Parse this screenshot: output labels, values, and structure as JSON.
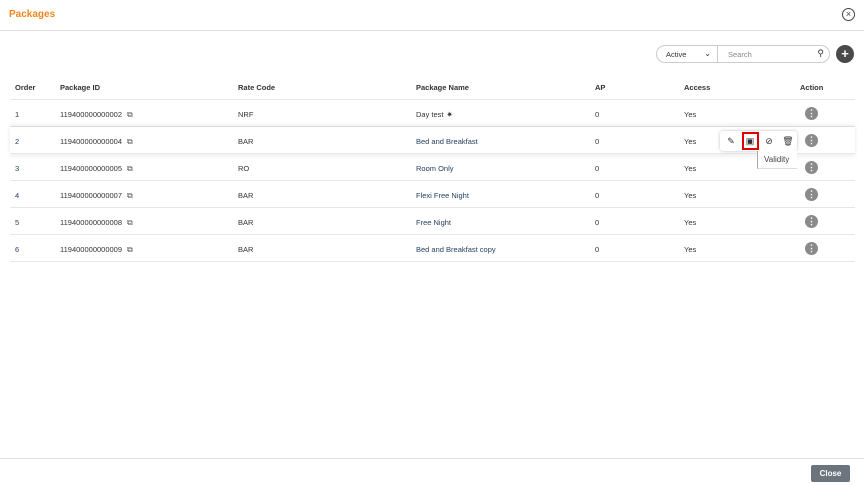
{
  "header": {
    "title": "Packages",
    "close_icon": "close-circle-icon"
  },
  "toolbar": {
    "status_filter": "Active",
    "search_placeholder": "Search",
    "add_label": "+"
  },
  "table": {
    "columns": [
      "Order",
      "Package ID",
      "Rate Code",
      "Package Name",
      "AP",
      "Access",
      "Action"
    ],
    "rows": [
      {
        "order": "1",
        "package_id": "119400000000002",
        "rate_code": "NRF",
        "name": "Day test",
        "ap": "0",
        "access": "Yes"
      },
      {
        "order": "2",
        "package_id": "119400000000004",
        "rate_code": "BAR",
        "name": "Bed and Breakfast",
        "ap": "0",
        "access": "Yes"
      },
      {
        "order": "3",
        "package_id": "119400000000005",
        "rate_code": "RO",
        "name": "Room Only",
        "ap": "0",
        "access": "Yes"
      },
      {
        "order": "4",
        "package_id": "119400000000007",
        "rate_code": "BAR",
        "name": "Flexi Free Night",
        "ap": "0",
        "access": "Yes"
      },
      {
        "order": "5",
        "package_id": "119400000000008",
        "rate_code": "BAR",
        "name": "Free Night",
        "ap": "0",
        "access": "Yes"
      },
      {
        "order": "6",
        "package_id": "119400000000009",
        "rate_code": "BAR",
        "name": "Bed and Breakfast copy",
        "ap": "0",
        "access": "Yes"
      }
    ]
  },
  "action_menu": {
    "items": [
      "edit",
      "validity",
      "disable",
      "delete"
    ],
    "tooltip": "Validity"
  },
  "footer": {
    "close_label": "Close"
  },
  "colors": {
    "accent": "#f0861f",
    "highlight": "#e00000"
  }
}
